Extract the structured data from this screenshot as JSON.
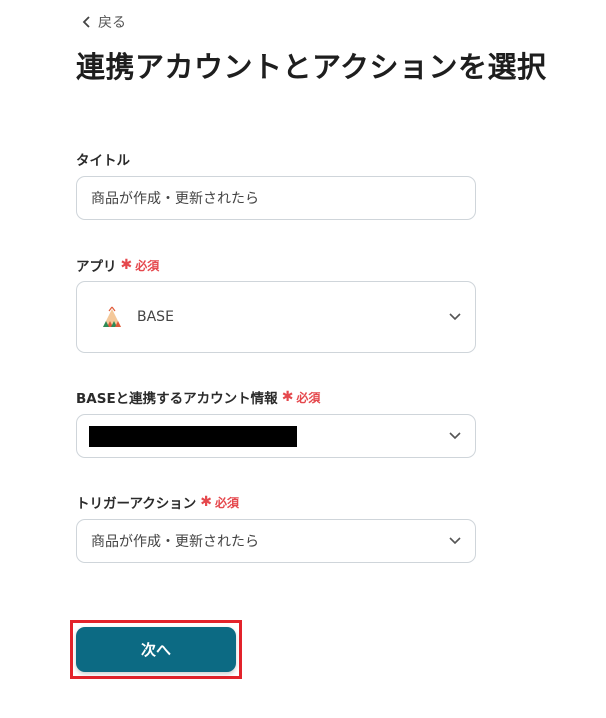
{
  "nav": {
    "back_label": "戻る"
  },
  "page_title": "連携アカウントとアクションを選択",
  "required_label": "必須",
  "fields": {
    "title": {
      "label": "タイトル",
      "value": "商品が作成・更新されたら"
    },
    "app": {
      "label": "アプリ",
      "value": "BASE"
    },
    "account": {
      "label": "BASEと連携するアカウント情報",
      "value": ""
    },
    "trigger": {
      "label": "トリガーアクション",
      "value": "商品が作成・更新されたら"
    }
  },
  "next_button": {
    "label": "次へ"
  },
  "colors": {
    "primary": "#0c6a83",
    "required": "#e5484d",
    "highlight": "#e3232b"
  }
}
